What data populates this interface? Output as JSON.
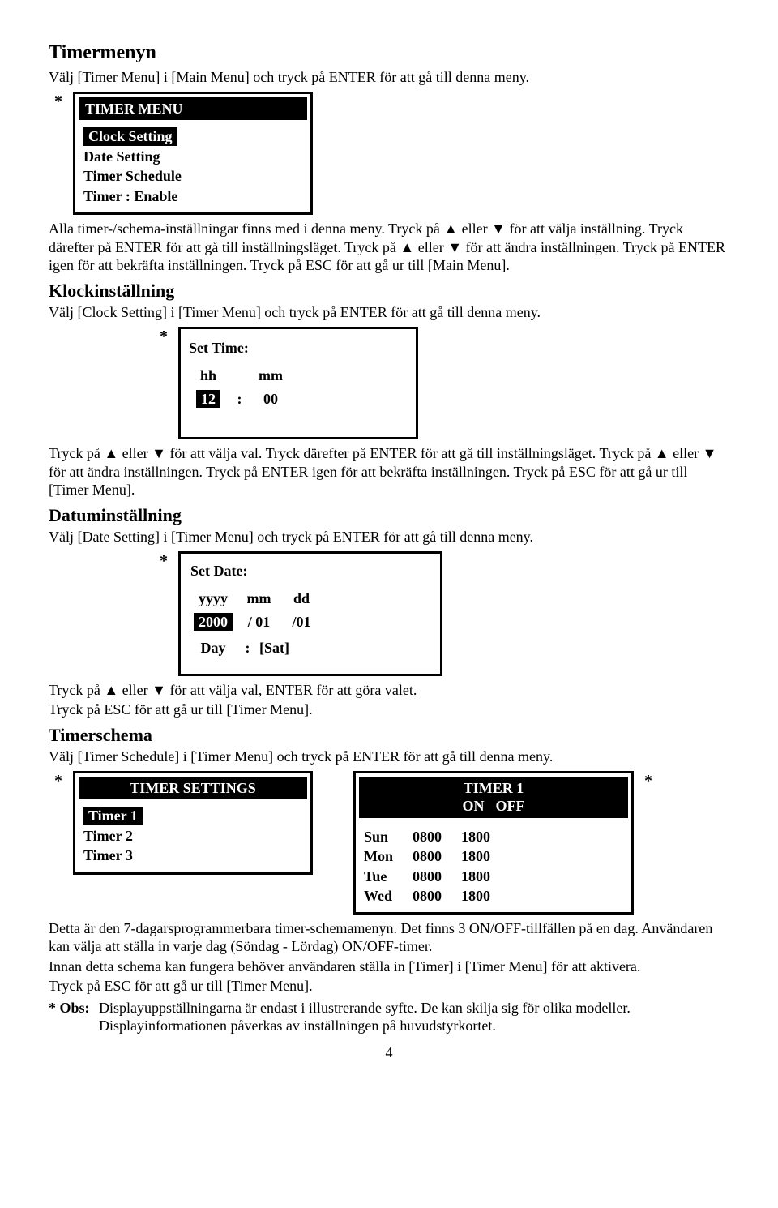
{
  "h1": "Timermenyn",
  "p_intro": "Välj [Timer Menu] i [Main Menu] och tryck på ENTER för att gå till denna meny.",
  "timer_menu": {
    "title": "TIMER MENU",
    "items": [
      "Clock Setting",
      "Date Setting",
      "Timer Schedule",
      "Timer : Enable"
    ],
    "selected_index": 0
  },
  "p_after_menu1": "Alla timer-/schema-inställningar finns med i denna meny. Tryck på ▲ eller ▼ för att välja inställning. Tryck därefter på ENTER för att gå till inställningsläget. Tryck på ▲ eller ▼ för att ändra inställningen. Tryck på ENTER igen för att bekräfta inställningen. Tryck på ESC för att gå ur till [Main Menu].",
  "h2_clock": "Klockinställning",
  "p_clock": "Välj [Clock Setting] i [Timer Menu] och tryck på ENTER för att gå till denna meny.",
  "set_time": {
    "title": "Set Time:",
    "hh_label": "hh",
    "mm_label": "mm",
    "hh": "12",
    "sep": ":",
    "mm": "00"
  },
  "p_after_time": "Tryck på ▲ eller ▼ för att välja val. Tryck därefter på ENTER för att gå till inställningsläget. Tryck på ▲ eller ▼ för att ändra inställningen. Tryck på ENTER igen för att bekräfta inställningen. Tryck på ESC för att gå ur till [Timer Menu].",
  "h2_date": "Datuminställning",
  "p_date": "Välj [Date Setting] i [Timer Menu] och tryck på ENTER för att gå till denna meny.",
  "set_date": {
    "title": "Set Date:",
    "yyyy_label": "yyyy",
    "mm_label": "mm",
    "dd_label": "dd",
    "yyyy": "2000",
    "mm": "/ 01",
    "dd": "/01",
    "day_label": "Day",
    "day_sep": ":",
    "day_value": "[Sat]"
  },
  "p_after_date_1": "Tryck på ▲ eller ▼ för att välja val, ENTER för att göra valet.",
  "p_after_date_2": "Tryck på ESC för att gå ur till [Timer Menu].",
  "h2_sched": "Timerschema",
  "p_sched": "Välj [Timer Schedule] i [Timer Menu] och tryck på ENTER för att gå till denna meny.",
  "timer_settings": {
    "title": "TIMER SETTINGS",
    "items": [
      "Timer   1",
      "Timer   2",
      "Timer   3"
    ],
    "selected_index": 0
  },
  "timer1": {
    "title": "TIMER 1",
    "col_on": "ON",
    "col_off": "OFF",
    "rows": [
      {
        "d": "Sun",
        "on": "0800",
        "off": "1800"
      },
      {
        "d": "Mon",
        "on": "0800",
        "off": "1800"
      },
      {
        "d": "Tue",
        "on": "0800",
        "off": "1800"
      },
      {
        "d": "Wed",
        "on": "0800",
        "off": "1800"
      }
    ]
  },
  "p_end_1": "Detta är den 7-dagarsprogrammerbara timer-schemamenyn. Det finns 3 ON/OFF-tillfällen på en dag. Användaren kan välja att ställa in varje dag (Söndag - Lördag) ON/OFF-timer.",
  "p_end_2": "Innan detta schema kan fungera behöver användaren ställa in [Timer] i [Timer Menu] för att aktivera.",
  "p_end_3": "Tryck på ESC för att gå ur till [Timer Menu].",
  "obs_label": "* Obs:",
  "obs_text": "Displayuppställningarna är endast i illustrerande syfte. De kan skilja sig för olika modeller. Displayinformationen påverkas av inställningen på huvudstyrkortet.",
  "page_number": "4",
  "star": "*"
}
